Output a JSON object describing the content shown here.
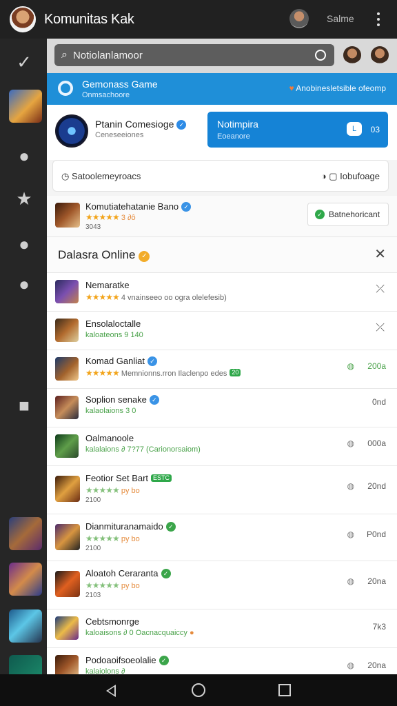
{
  "topbar": {
    "title": "Komunitas Kak",
    "user_name": "Salme"
  },
  "search": {
    "placeholder": "Notiolanlamoor"
  },
  "info_bar": {
    "title": "Gemonass Game",
    "subtitle": "Onmsachoore",
    "right_text": "Anobinesletsible ofeomp"
  },
  "promo": {
    "name": "Ptanin Comesioge",
    "sub": "Ceneseeiones",
    "cta_title": "Notimpira",
    "cta_sub": "Eoeanore",
    "cta_pill": "L",
    "cta_num": "03"
  },
  "filter": {
    "left_label": "Satoolemeyroacs",
    "right_label": "Iobufoage"
  },
  "featured": {
    "name": "Komutiatehatanie Bano",
    "sub_text": "3 ∂ô",
    "third_text": "3043",
    "status_label": "Batnehoricant"
  },
  "section": {
    "title": "Dalasra Online"
  },
  "items": [
    {
      "name": "Nemaratke",
      "sub_text": "4 vnainseeo oo ogra olelefesib)",
      "right": ""
    },
    {
      "name": "Ensolaloctalle",
      "sub_text": "kaloateons 9 140",
      "right": ""
    },
    {
      "name": "Komad Ganliat",
      "sub_text": "Memnionns.rron Ilaclenpo edes",
      "tag": "20",
      "right": "200a"
    },
    {
      "name": "Soplion senake",
      "sub_text": "kalaolaions 3 0",
      "right": "0nd"
    },
    {
      "name": "Oalmanoole",
      "sub_text": "kalalaions ∂ 7?77 (Carionorsaiom)",
      "right": "000a"
    },
    {
      "name": "Feotior Set Bart",
      "tag": "ESTC",
      "sub_text": "py bo",
      "third": "2100",
      "right": "20nd"
    },
    {
      "name": "Dianmituranamaido",
      "sub_text": "py bo",
      "third": "2100",
      "right": "P0nd"
    },
    {
      "name": "Aloatoh Ceraranta",
      "sub_text": "py bo",
      "third": "2103",
      "right": "20na"
    },
    {
      "name": "Cebtsmonrge",
      "sub_text": "kaloaisons ∂ 0 Oacnacquaiccy",
      "right": "7k3"
    },
    {
      "name": "Podoaoifsoeolalie",
      "sub_text": "kalaiolons ∂",
      "right": "20na"
    }
  ]
}
